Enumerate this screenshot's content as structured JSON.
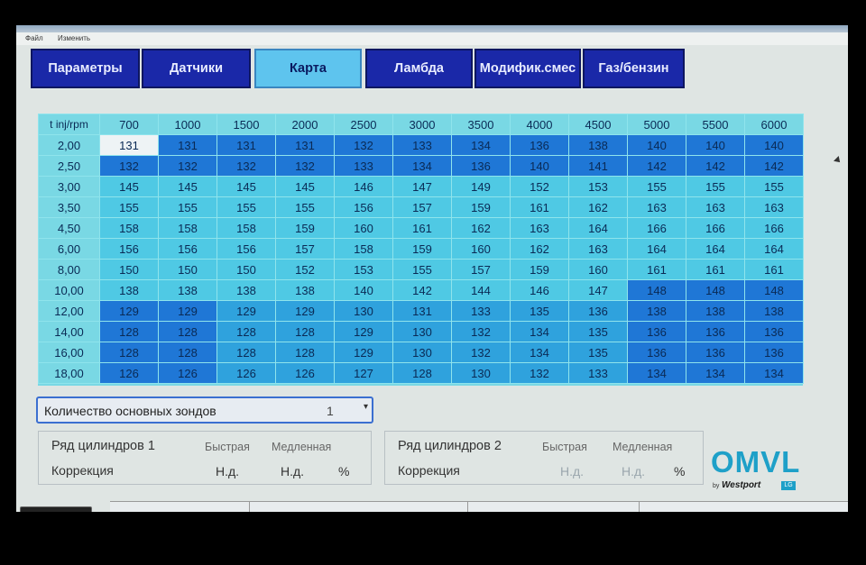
{
  "menu": {
    "file": "Файл",
    "edit": "Изменить"
  },
  "tabs": [
    {
      "label": "Параметры",
      "active": false
    },
    {
      "label": "Датчики",
      "active": false
    },
    {
      "label": "Карта",
      "active": true
    },
    {
      "label": "Ламбда",
      "active": false
    },
    {
      "label": "Модифик.смес",
      "active": false
    },
    {
      "label": "Газ/бензин",
      "active": false
    }
  ],
  "map": {
    "corner_label": "t inj/rpm",
    "rpm": [
      "700",
      "1000",
      "1500",
      "2000",
      "2500",
      "3000",
      "3500",
      "4000",
      "4500",
      "5000",
      "5500",
      "6000"
    ],
    "rows": [
      {
        "t": "2,00",
        "values": [
          "131",
          "131",
          "131",
          "131",
          "132",
          "133",
          "134",
          "136",
          "138",
          "140",
          "140",
          "140"
        ]
      },
      {
        "t": "2,50",
        "values": [
          "132",
          "132",
          "132",
          "132",
          "133",
          "134",
          "136",
          "140",
          "141",
          "142",
          "142",
          "142"
        ]
      },
      {
        "t": "3,00",
        "values": [
          "145",
          "145",
          "145",
          "145",
          "146",
          "147",
          "149",
          "152",
          "153",
          "155",
          "155",
          "155"
        ]
      },
      {
        "t": "3,50",
        "values": [
          "155",
          "155",
          "155",
          "155",
          "156",
          "157",
          "159",
          "161",
          "162",
          "163",
          "163",
          "163"
        ]
      },
      {
        "t": "4,50",
        "values": [
          "158",
          "158",
          "158",
          "159",
          "160",
          "161",
          "162",
          "163",
          "164",
          "166",
          "166",
          "166"
        ]
      },
      {
        "t": "6,00",
        "values": [
          "156",
          "156",
          "156",
          "157",
          "158",
          "159",
          "160",
          "162",
          "163",
          "164",
          "164",
          "164"
        ]
      },
      {
        "t": "8,00",
        "values": [
          "150",
          "150",
          "150",
          "152",
          "153",
          "155",
          "157",
          "159",
          "160",
          "161",
          "161",
          "161"
        ]
      },
      {
        "t": "10,00",
        "values": [
          "138",
          "138",
          "138",
          "138",
          "140",
          "142",
          "144",
          "146",
          "147",
          "148",
          "148",
          "148"
        ]
      },
      {
        "t": "12,00",
        "values": [
          "129",
          "129",
          "129",
          "129",
          "130",
          "131",
          "133",
          "135",
          "136",
          "138",
          "138",
          "138"
        ]
      },
      {
        "t": "14,00",
        "values": [
          "128",
          "128",
          "128",
          "128",
          "129",
          "130",
          "132",
          "134",
          "135",
          "136",
          "136",
          "136"
        ]
      },
      {
        "t": "16,00",
        "values": [
          "128",
          "128",
          "128",
          "128",
          "129",
          "130",
          "132",
          "134",
          "135",
          "136",
          "136",
          "136"
        ]
      },
      {
        "t": "18,00",
        "values": [
          "126",
          "126",
          "126",
          "126",
          "127",
          "128",
          "130",
          "132",
          "133",
          "134",
          "134",
          "134"
        ]
      }
    ]
  },
  "sensors": {
    "label": "Количество основных зондов",
    "value": "1"
  },
  "bank1": {
    "title": "Ряд цилиндров 1",
    "fast_label": "Быстрая",
    "slow_label": "Медленная",
    "correction_label": "Коррекция",
    "fast_value": "Н.д.",
    "slow_value": "Н.д.",
    "unit": "%"
  },
  "bank2": {
    "title": "Ряд цилиндров 2",
    "fast_label": "Быстрая",
    "slow_label": "Медленная",
    "correction_label": "Коррекция",
    "fast_value": "Н.д.",
    "slow_value": "Н.д.",
    "unit": "%"
  },
  "logo": {
    "brand": "OMVL",
    "by": "by",
    "company": "Westport",
    "badge": "LG"
  },
  "colors": {
    "selected": "#eef3f5",
    "light": "#4fc9e4",
    "mid": "#2fa2dd",
    "dark": "#1f77d6",
    "header": "#79d8e4"
  }
}
